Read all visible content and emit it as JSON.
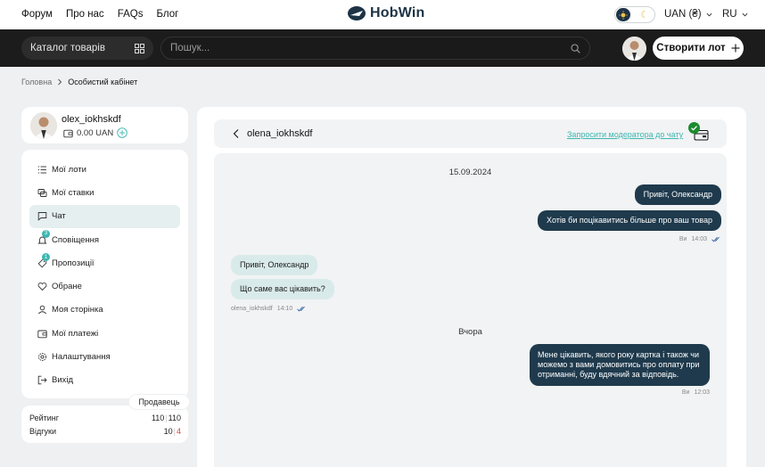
{
  "nav": {
    "links": [
      "Форум",
      "Про нас",
      "FAQs",
      "Блог"
    ],
    "logo_text": "HobWin",
    "currency": "UAN (₴)",
    "language": "RU"
  },
  "toolbar": {
    "catalog_label": "Каталог товарів",
    "search_placeholder": "Пошук...",
    "create_label": "Створити лот"
  },
  "breadcrumb": {
    "home": "Головна",
    "current": "Особистий кабінет"
  },
  "profile": {
    "username": "olex_iokhskdf",
    "balance": "0.00 UAN"
  },
  "sidebar": {
    "items": [
      {
        "label": "Мої лоти",
        "icon": "list-icon"
      },
      {
        "label": "Мої ставки",
        "icon": "bids-icon"
      },
      {
        "label": "Чат",
        "icon": "chat-icon",
        "active": true
      },
      {
        "label": "Сповіщення",
        "icon": "bell-icon",
        "badge": "3"
      },
      {
        "label": "Пропозиції",
        "icon": "tag-icon",
        "badge": "1"
      },
      {
        "label": "Обране",
        "icon": "heart-icon"
      },
      {
        "label": "Моя сторінка",
        "icon": "user-icon"
      },
      {
        "label": "Мої платежі",
        "icon": "wallet-icon"
      },
      {
        "label": "Налаштування",
        "icon": "gear-icon"
      },
      {
        "label": "Вихід",
        "icon": "logout-icon"
      }
    ],
    "role_tag": "Продавець",
    "stats": {
      "rating_label": "Рейтинг",
      "rating_a": "110",
      "rating_b": "110",
      "reviews_label": "Відгуки",
      "reviews_pos": "10",
      "reviews_neg": "4"
    }
  },
  "chat": {
    "peer_name": "olena_iokhskdf",
    "moderator_link": "Запросити модератора до чату",
    "date_1": "15.09.2024",
    "date_2": "Вчора",
    "messages": [
      {
        "text": "Привіт, Олександр",
        "side": "out"
      },
      {
        "text": "Хотів би поцікавитись більше про ваш товар",
        "side": "out"
      },
      {
        "text": "Привіт, Олександр",
        "side": "in"
      },
      {
        "text": "Що саме вас цікавить?",
        "side": "in"
      },
      {
        "text": "Мене цікавить, якого року картка і також чи можемо з вами домовитись про оплату при отриманні, буду вдячний за відповідь.",
        "side": "out"
      }
    ],
    "meta_1": {
      "author": "Ви",
      "time": "14:03"
    },
    "meta_2": {
      "author": "olena_iokhskdf",
      "time": "14:10"
    },
    "meta_3": {
      "author": "Ви",
      "time": "12:03"
    }
  },
  "colors": {
    "accent": "#3fb7b2",
    "navy": "#1f3a4d",
    "incoming_bubble": "#d9eaea",
    "negative": "#e23b3b"
  }
}
